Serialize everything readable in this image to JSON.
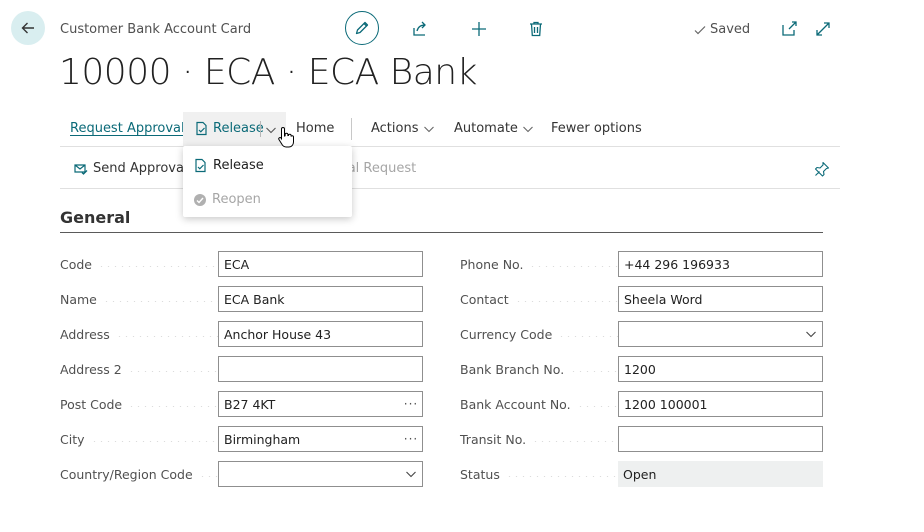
{
  "header": {
    "caption": "Customer Bank Account Card",
    "title": "10000 · ECA · ECA Bank",
    "saved_label": "Saved"
  },
  "action_bar": {
    "request_approval": "Request Approval",
    "release": "Release",
    "home": "Home",
    "actions": "Actions",
    "automate": "Automate",
    "fewer_options": "Fewer options"
  },
  "secondary_bar": {
    "send_approval": "Send Approval R",
    "cancel_request_partial": "val Request"
  },
  "release_menu": {
    "items": [
      {
        "label": "Release",
        "enabled": true
      },
      {
        "label": "Reopen",
        "enabled": false
      }
    ]
  },
  "section": {
    "title": "General"
  },
  "fields_left": [
    {
      "label": "Code",
      "value": "ECA",
      "suffix": ""
    },
    {
      "label": "Name",
      "value": "ECA Bank",
      "suffix": ""
    },
    {
      "label": "Address",
      "value": "Anchor House 43",
      "suffix": ""
    },
    {
      "label": "Address 2",
      "value": "",
      "suffix": ""
    },
    {
      "label": "Post Code",
      "value": "B27 4KT",
      "suffix": "···"
    },
    {
      "label": "City",
      "value": "Birmingham",
      "suffix": "···"
    },
    {
      "label": "Country/Region Code",
      "value": "",
      "suffix": "dropdown"
    }
  ],
  "fields_right": [
    {
      "label": "Phone No.",
      "value": "+44 296 196933",
      "suffix": ""
    },
    {
      "label": "Contact",
      "value": "Sheela Word",
      "suffix": ""
    },
    {
      "label": "Currency Code",
      "value": "",
      "suffix": "dropdown"
    },
    {
      "label": "Bank Branch No.",
      "value": "1200",
      "suffix": ""
    },
    {
      "label": "Bank Account No.",
      "value": "1200 100001",
      "suffix": ""
    },
    {
      "label": "Transit No.",
      "value": "",
      "suffix": ""
    },
    {
      "label": "Status",
      "value": "Open",
      "suffix": "",
      "readonly": true
    }
  ],
  "colors": {
    "accent": "#0b6a78",
    "back_button_bg": "#d9eef0",
    "readonly_bg": "#eef0f0"
  },
  "icons": {
    "back": "arrow-left-icon",
    "edit": "pencil-icon",
    "share": "share-icon",
    "new": "plus-icon",
    "delete": "trash-icon",
    "saved": "check-icon",
    "open_new_window": "open-new-window-icon",
    "expand": "expand-icon",
    "release": "document-check-icon",
    "reopen": "reopen-icon",
    "send_approval": "envelope-check-icon",
    "pin": "pin-icon"
  }
}
